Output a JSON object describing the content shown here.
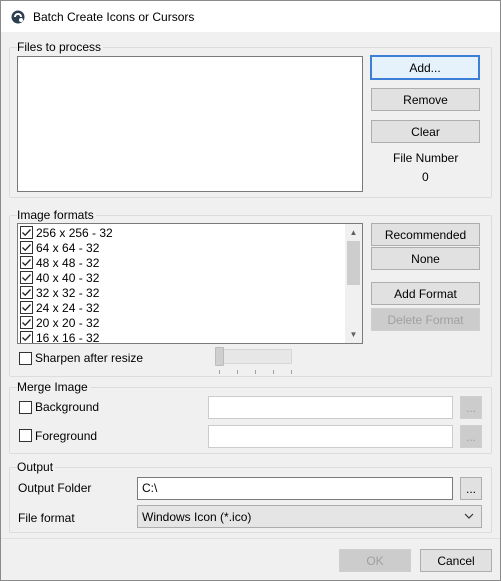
{
  "window": {
    "title": "Batch Create Icons or Cursors",
    "icon": "app-logo-icon"
  },
  "files": {
    "group_title": "Files to process",
    "add_label": "Add...",
    "remove_label": "Remove",
    "clear_label": "Clear",
    "file_number_label": "File Number",
    "file_number_value": "0"
  },
  "formats": {
    "group_title": "Image formats",
    "items": [
      {
        "label": "256 x 256 - 32",
        "checked": true
      },
      {
        "label": "64 x 64 - 32",
        "checked": true
      },
      {
        "label": "48 x 48 - 32",
        "checked": true
      },
      {
        "label": "40 x 40 - 32",
        "checked": true
      },
      {
        "label": "32 x 32 - 32",
        "checked": true
      },
      {
        "label": "24 x 24 - 32",
        "checked": true
      },
      {
        "label": "20 x 20 - 32",
        "checked": true
      },
      {
        "label": "16 x 16 - 32",
        "checked": true
      }
    ],
    "recommended_label": "Recommended",
    "none_label": "None",
    "add_format_label": "Add Format",
    "delete_format_label": "Delete Format",
    "sharpen_label": "Sharpen after resize",
    "sharpen_checked": false
  },
  "merge": {
    "group_title": "Merge Image",
    "background_label": "Background",
    "background_value": "",
    "foreground_label": "Foreground",
    "foreground_value": "",
    "browse_label": "..."
  },
  "output": {
    "group_title": "Output",
    "folder_label": "Output Folder",
    "folder_value": "C:\\",
    "browse_label": "...",
    "format_label": "File format",
    "format_value": "Windows Icon (*.ico)"
  },
  "footer": {
    "ok_label": "OK",
    "cancel_label": "Cancel"
  },
  "colors": {
    "accent": "#3c7fd6",
    "disabled_text": "#a0a0a0"
  }
}
